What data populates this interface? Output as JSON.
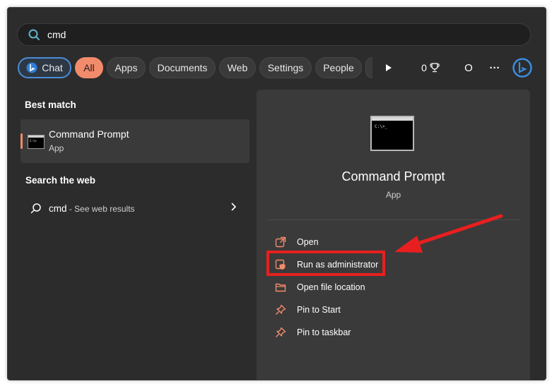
{
  "search": {
    "query": "cmd",
    "icon": "search-icon"
  },
  "tabs": {
    "chat": "Chat",
    "all": "All",
    "apps": "Apps",
    "documents": "Documents",
    "web": "Web",
    "settings": "Settings",
    "people": "People",
    "points": "0",
    "profile": "O",
    "more": "···"
  },
  "left": {
    "best_match_title": "Best match",
    "best_match": {
      "name": "Command Prompt",
      "type": "App"
    },
    "search_web_title": "Search the web",
    "web_query": "cmd",
    "web_suffix": " - See web results"
  },
  "right": {
    "title": "Command Prompt",
    "type": "App",
    "actions": [
      {
        "label": "Open",
        "icon": "open-icon"
      },
      {
        "label": "Run as administrator",
        "icon": "shield-icon"
      },
      {
        "label": "Open file location",
        "icon": "folder-icon"
      },
      {
        "label": "Pin to Start",
        "icon": "pin-icon"
      },
      {
        "label": "Pin to taskbar",
        "icon": "pin-icon"
      }
    ]
  },
  "colors": {
    "accent": "#f28b6b",
    "panel": "#2c2c2c",
    "highlight": "#e81f1f",
    "chat_border": "#4a8ed8"
  }
}
